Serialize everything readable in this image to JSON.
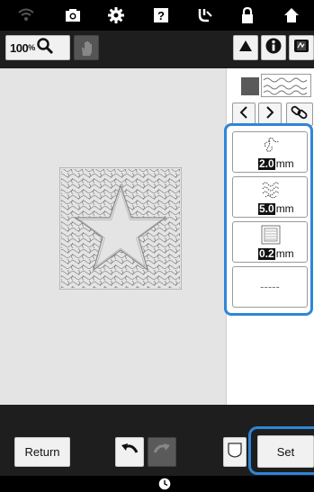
{
  "topbar": {
    "icons": [
      "wifi-icon",
      "camera-icon",
      "gear-icon",
      "help-icon",
      "thread-icon",
      "lock-icon",
      "home-icon"
    ]
  },
  "toolbar": {
    "zoom_value": "100",
    "zoom_unit": "%",
    "right_icons": [
      "triangle-icon",
      "info-icon",
      "film-icon"
    ]
  },
  "panel": {
    "options": [
      {
        "value": "2.0",
        "unit": "mm",
        "icon": "stipple-sparse-icon"
      },
      {
        "value": "5.0",
        "unit": "mm",
        "icon": "stipple-dense-icon"
      },
      {
        "value": "0.2",
        "unit": "mm",
        "icon": "fill-pattern-icon"
      },
      {
        "placeholder": "-----"
      }
    ]
  },
  "bottom": {
    "return_label": "Return",
    "set_label": "Set"
  },
  "colors": {
    "highlight": "#2f86d6",
    "canvas": "#e4e4e4",
    "bar": "#1e1e1e"
  }
}
